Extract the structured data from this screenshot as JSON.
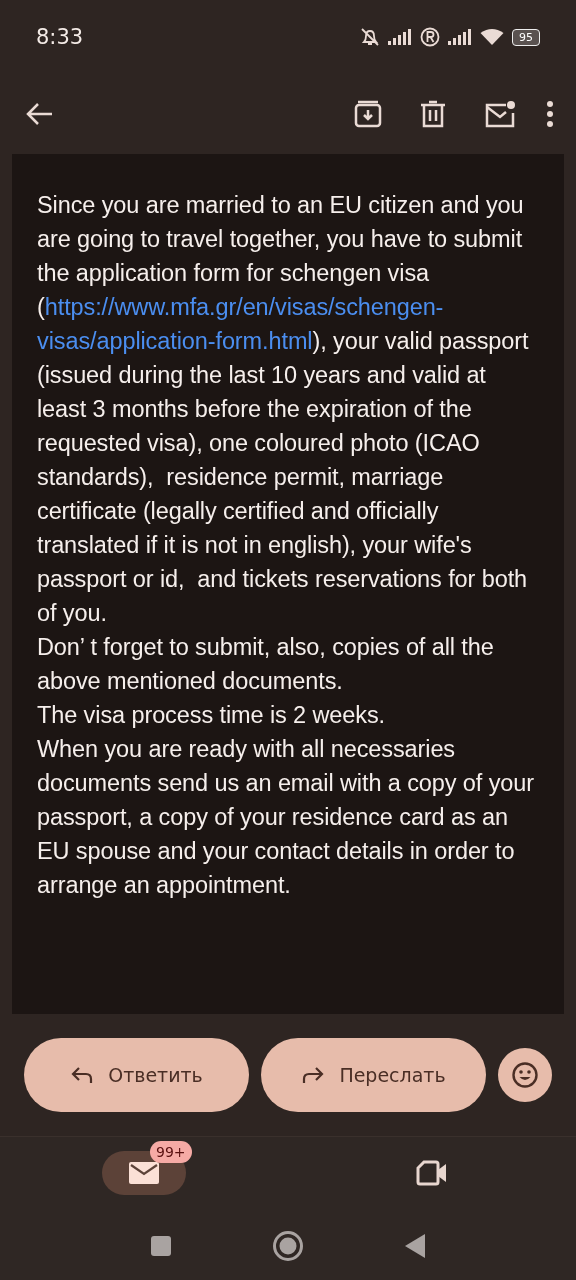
{
  "status_bar": {
    "time": "8:33",
    "battery": "95"
  },
  "message": {
    "paragraphs": [
      {
        "kind": "linked",
        "before": "Since you are married to an EU citizen and you are going to travel together, you have to submit the application form for schengen visa (",
        "link_lines": [
          "https://www.mfa.gr/en/visas/schengen-",
          "visas/application-form.html"
        ],
        "after": "), your valid passport (issued during the last 10 years and valid at least 3 months before the expiration of the requested visa), one coloured photo (ICAO standards),  residence permit, marriage certificate (legally certified and officially translated if it is not in english), your wife's passport or id,  and tickets reservations for both of you."
      },
      {
        "kind": "plain",
        "text": "Don’ t forget to submit, also, copies of all the above mentioned documents."
      },
      {
        "kind": "plain",
        "text": "The visa process time is 2 weeks."
      },
      {
        "kind": "plain",
        "text": "When you are ready with all necessaries documents send us an email with a copy of your passport, a copy of your residence card as an EU spouse and your contact details in order to arrange an appointment."
      }
    ]
  },
  "actions": [
    {
      "kind": "reply",
      "label": "Ответить"
    },
    {
      "kind": "forward",
      "label": "Переслать"
    }
  ],
  "bottom_nav": [
    {
      "kind": "mail",
      "selected": true,
      "badge": "99+"
    },
    {
      "kind": "meet",
      "selected": false
    }
  ]
}
